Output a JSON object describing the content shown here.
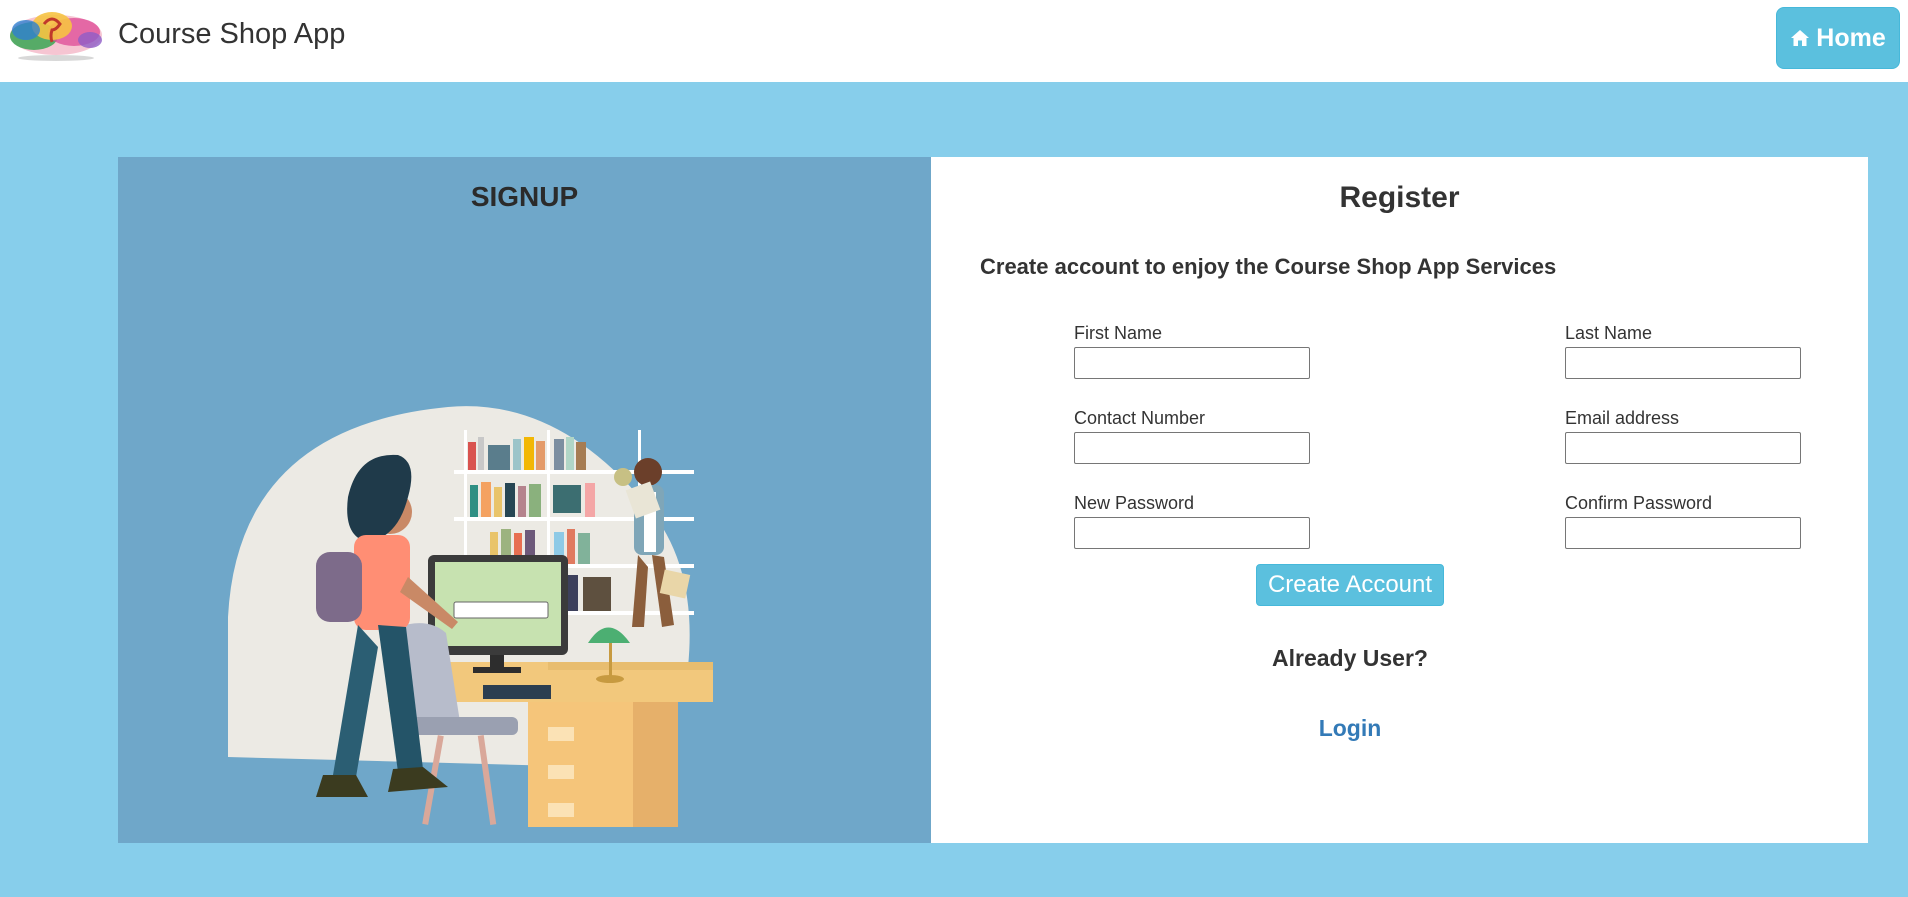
{
  "navbar": {
    "brand": "Course Shop App",
    "logo_icon": "brain-watercolor-logo",
    "home_icon": "home-icon",
    "home_label": "Home"
  },
  "left_panel": {
    "title": "SIGNUP",
    "illustration": "students-library-illustration"
  },
  "form": {
    "title": "Register",
    "subtitle": "Create account to enjoy the Course Shop App Services",
    "fields": {
      "first_name": {
        "label": "First Name",
        "value": ""
      },
      "last_name": {
        "label": "Last Name",
        "value": ""
      },
      "contact": {
        "label": "Contact Number",
        "value": ""
      },
      "email": {
        "label": "Email address",
        "value": ""
      },
      "password": {
        "label": "New Password",
        "value": ""
      },
      "confirm": {
        "label": "Confirm Password",
        "value": ""
      }
    },
    "submit_label": "Create Account",
    "already_user": "Already User?",
    "login_link": "Login"
  },
  "colors": {
    "page_background": "#87ceeb",
    "panel_blue": "#6fa7c9",
    "accent": "#5bc0de",
    "link": "#337ab7"
  }
}
